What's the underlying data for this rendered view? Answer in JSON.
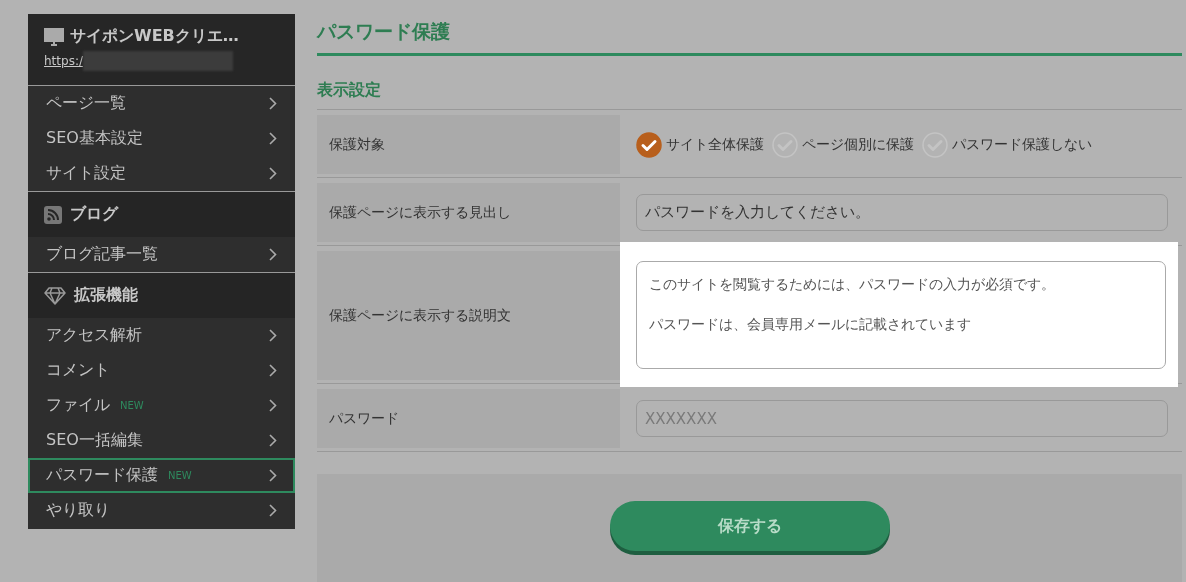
{
  "sidebar": {
    "site": {
      "title": "サイポンWEBクリエ…",
      "url": "https:/"
    },
    "groups": [
      {
        "items": [
          {
            "label": "ページ一覧",
            "selected": false
          },
          {
            "label": "SEO基本設定",
            "selected": false
          },
          {
            "label": "サイト設定",
            "selected": false
          }
        ]
      },
      {
        "title": "ブログ",
        "items": [
          {
            "label": "ブログ記事一覧",
            "selected": false
          }
        ]
      },
      {
        "title": "拡張機能",
        "items": [
          {
            "label": "アクセス解析",
            "selected": false
          },
          {
            "label": "コメント",
            "selected": false
          },
          {
            "label": "ファイル",
            "badge": "NEW",
            "selected": false
          },
          {
            "label": "SEO一括編集",
            "selected": false
          },
          {
            "label": "パスワード保護",
            "badge": "NEW",
            "selected": true
          },
          {
            "label": "やり取り",
            "selected": false
          }
        ]
      }
    ]
  },
  "page": {
    "title": "パスワード保護",
    "section": "表示設定",
    "rows": [
      {
        "label": "保護対象",
        "kind": "radio",
        "options": [
          {
            "label": "サイト全体保護",
            "selected": true
          },
          {
            "label": "ページ個別に保護",
            "selected": false
          },
          {
            "label": "パスワード保護しない",
            "selected": false
          }
        ]
      },
      {
        "label": "保護ページに表示する見出し",
        "kind": "input",
        "value": "パスワードを入力してください。"
      },
      {
        "label": "保護ページに表示する説明文",
        "kind": "textarea",
        "highlighted": true,
        "paragraphs": [
          "このサイトを閲覧するためには、パスワードの入力が必須です。",
          "パスワードは、会員専用メールに記載されています"
        ]
      },
      {
        "label": "パスワード",
        "kind": "input",
        "placeholder": "XXXXXXX"
      }
    ],
    "save_button": "保存する"
  }
}
